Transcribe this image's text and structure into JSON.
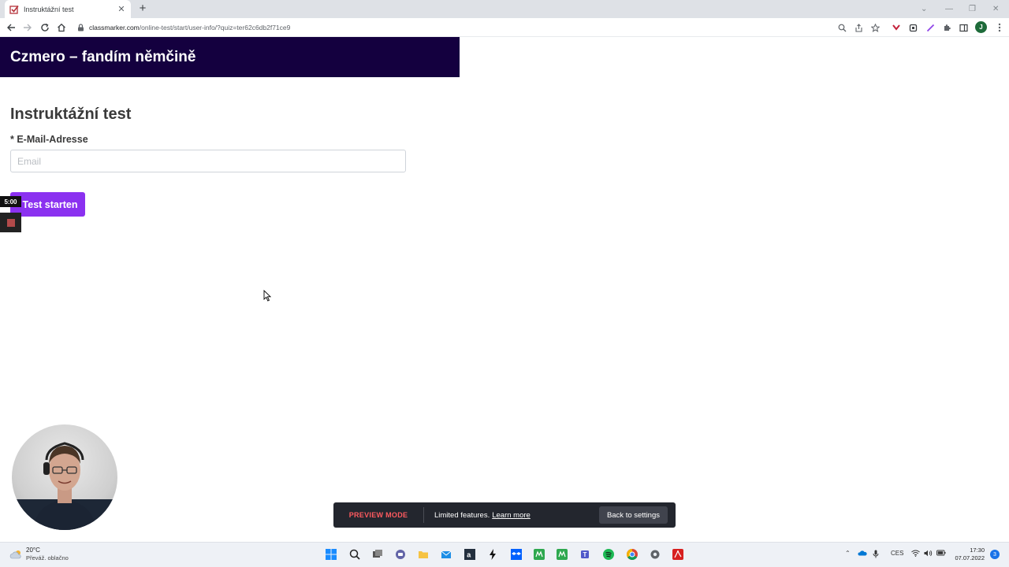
{
  "browser": {
    "tab_title": "Instruktážní test",
    "url_host": "classmarker.com",
    "url_path": "/online-test/start/user-info/?quiz=ter62c6db2f71ce9",
    "profile_initial": "J"
  },
  "page": {
    "site_title": "Czmero – fandím němčině",
    "test_title": "Instruktážní test",
    "email_label": "* E-Mail-Adresse",
    "email_placeholder": "Email",
    "email_value": "",
    "start_button": "Test starten"
  },
  "recorder": {
    "timer": "5:00"
  },
  "preview_bar": {
    "mode_label": "PREVIEW MODE",
    "info_text": "Limited features.",
    "learn_more": "Learn more",
    "back_button": "Back to settings"
  },
  "taskbar": {
    "weather_temp": "20°C",
    "weather_desc": "Převáž. oblačno",
    "language": "CES",
    "time": "17:30",
    "date": "07.07.2022",
    "notification_count": "3"
  },
  "colors": {
    "header_bg": "#14003f",
    "start_button": "#8b31f0",
    "preview_mode": "#ff5a5f",
    "preview_bar_bg": "#23262e"
  }
}
